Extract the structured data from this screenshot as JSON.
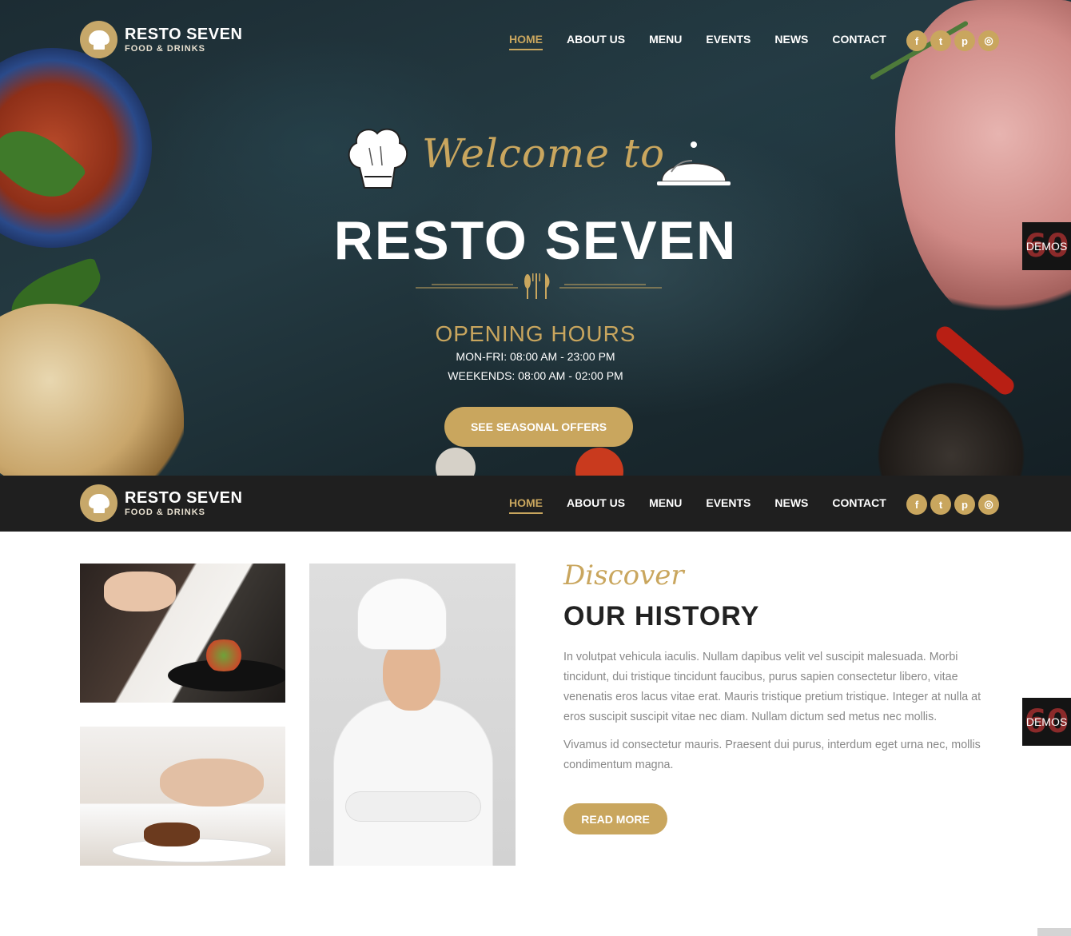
{
  "brand": {
    "name": "RESTO SEVEN",
    "tagline": "FOOD & DRINKS"
  },
  "nav": {
    "items": [
      {
        "label": "HOME",
        "active": true
      },
      {
        "label": "ABOUT US",
        "active": false
      },
      {
        "label": "MENU",
        "active": false
      },
      {
        "label": "EVENTS",
        "active": false
      },
      {
        "label": "NEWS",
        "active": false
      },
      {
        "label": "CONTACT",
        "active": false
      }
    ]
  },
  "socials": [
    {
      "icon": "facebook-icon",
      "glyph": "f"
    },
    {
      "icon": "twitter-icon",
      "glyph": "t"
    },
    {
      "icon": "pinterest-icon",
      "glyph": "p"
    },
    {
      "icon": "instagram-icon",
      "glyph": "◎"
    }
  ],
  "hero": {
    "welcome": "Welcome to",
    "title": "RESTO SEVEN",
    "hours_title": "OPENING HOURS",
    "hours_weekdays": "MON-FRI: 08:00 AM - 23:00 PM",
    "hours_weekends": "WEEKENDS: 08:00 AM - 02:00 PM",
    "cta": "SEE SEASONAL OFFERS"
  },
  "demos": {
    "number": "60",
    "label": "DEMOS"
  },
  "history": {
    "script": "Discover",
    "title": "OUR HISTORY",
    "paragraph1": "In volutpat vehicula iaculis. Nullam dapibus velit vel suscipit malesuada. Morbi tincidunt, dui tristique tincidunt faucibus, purus sapien consectetur libero, vitae venenatis eros lacus vitae erat. Mauris tristique pretium tristique. Integer at nulla at eros suscipit suscipit vitae nec diam. Nullam dictum sed metus nec mollis.",
    "paragraph2": "Vivamus id consectetur mauris. Praesent dui purus, interdum eget urna nec, mollis condimentum magna.",
    "button": "READ MORE"
  },
  "colors": {
    "accent": "#c9a65e",
    "dark": "#1f1f1f"
  }
}
